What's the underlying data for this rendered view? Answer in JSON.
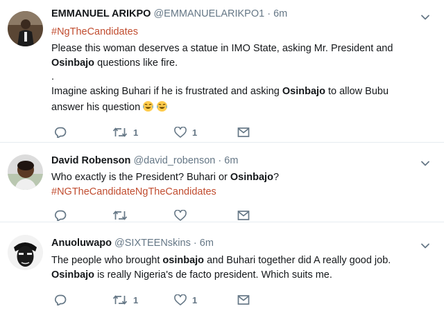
{
  "tweets": [
    {
      "name": "EMMANUEL ARIKPO",
      "handle": "@EMMANUELARIKPO1",
      "dot": "·",
      "time": "6m",
      "hashtag": "#NgTheCandidates",
      "line1": "Please this woman deserves a statue in IMO State,  asking Mr. President and",
      "line2_bold": "Osinbajo",
      "line2_rest": " questions like fire.",
      "line3": ".",
      "line4_a": "Imagine asking Buhari if he is frustrated and asking ",
      "line4_bold": "Osinbajo",
      "line4_b": " to allow Bubu",
      "line5": "answer his question",
      "retweets": "1",
      "likes": "1"
    },
    {
      "name": "David Robenson",
      "handle": "@david_robenson",
      "dot": "·",
      "time": "6m",
      "line1_a": "Who exactly is the President? Buhari or ",
      "line1_bold": "Osinbajo",
      "line1_b": "?",
      "hashtag": "#NGTheCandidateNgTheCandidates",
      "retweets": "",
      "likes": ""
    },
    {
      "name": "Anuoluwapo",
      "handle": "@SIXTEENskins",
      "dot": "·",
      "time": "6m",
      "line1_a": "The people who brought ",
      "line1_bold": "osinbajo",
      "line1_b": " and Buhari together did A really good job.",
      "line2_bold": "Osinbajo",
      "line2_rest": " is really Nigeria's de facto president. Which suits me.",
      "retweets": "1",
      "likes": "1"
    }
  ],
  "colors": {
    "hashtag": "#c14d30",
    "meta": "#657786",
    "divider": "#e6ecf0"
  },
  "icons": [
    "reply-icon",
    "retweet-icon",
    "like-icon",
    "message-icon",
    "chevron-down-icon"
  ]
}
